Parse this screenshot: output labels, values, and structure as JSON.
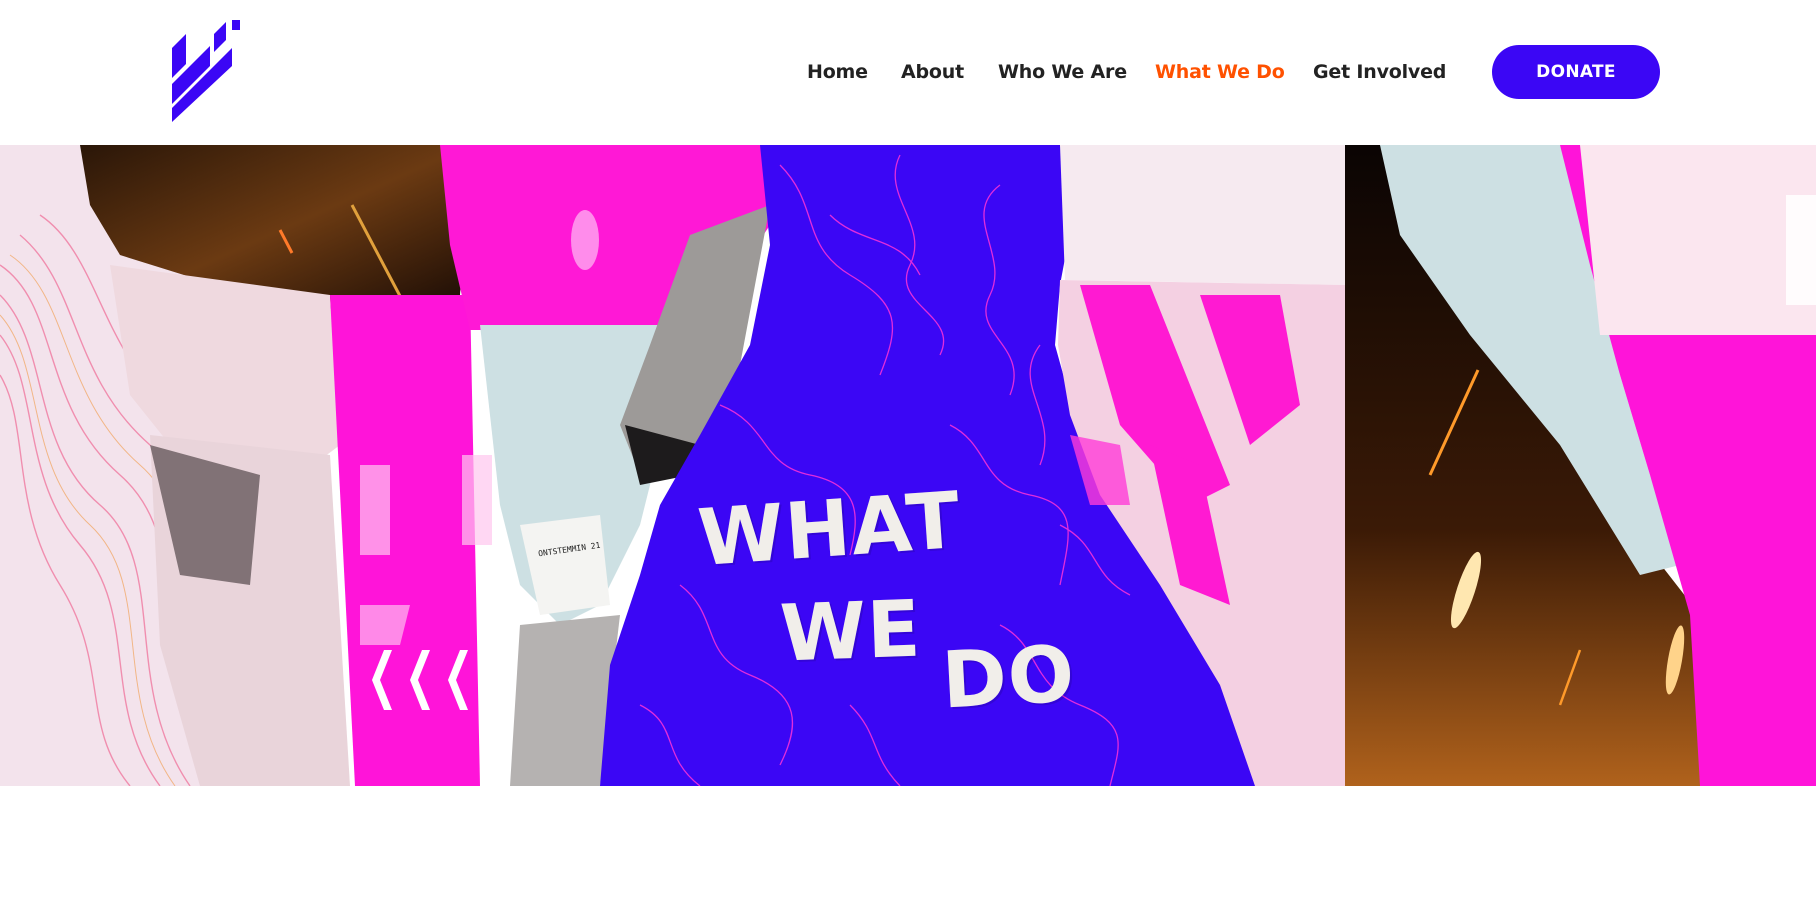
{
  "header": {
    "logo_icon": "brand-logo-icon",
    "nav": [
      {
        "label": "Home",
        "active": false
      },
      {
        "label": "About",
        "active": false
      },
      {
        "label": "Who We Are",
        "active": false
      },
      {
        "label": "What We Do",
        "active": true
      },
      {
        "label": "Get Involved",
        "active": false
      }
    ],
    "donate_label": "DONATE"
  },
  "hero": {
    "title_lines": [
      "WHAT",
      "WE",
      "DO"
    ],
    "poster_text_1": "ONTSTEMMIN",
    "poster_text_2": "21"
  },
  "colors": {
    "brand": "#3b06f5",
    "active_nav": "#ff5100",
    "nav_text": "#222222",
    "magenta": "#ff14d9",
    "blue": "#3b06f5"
  }
}
